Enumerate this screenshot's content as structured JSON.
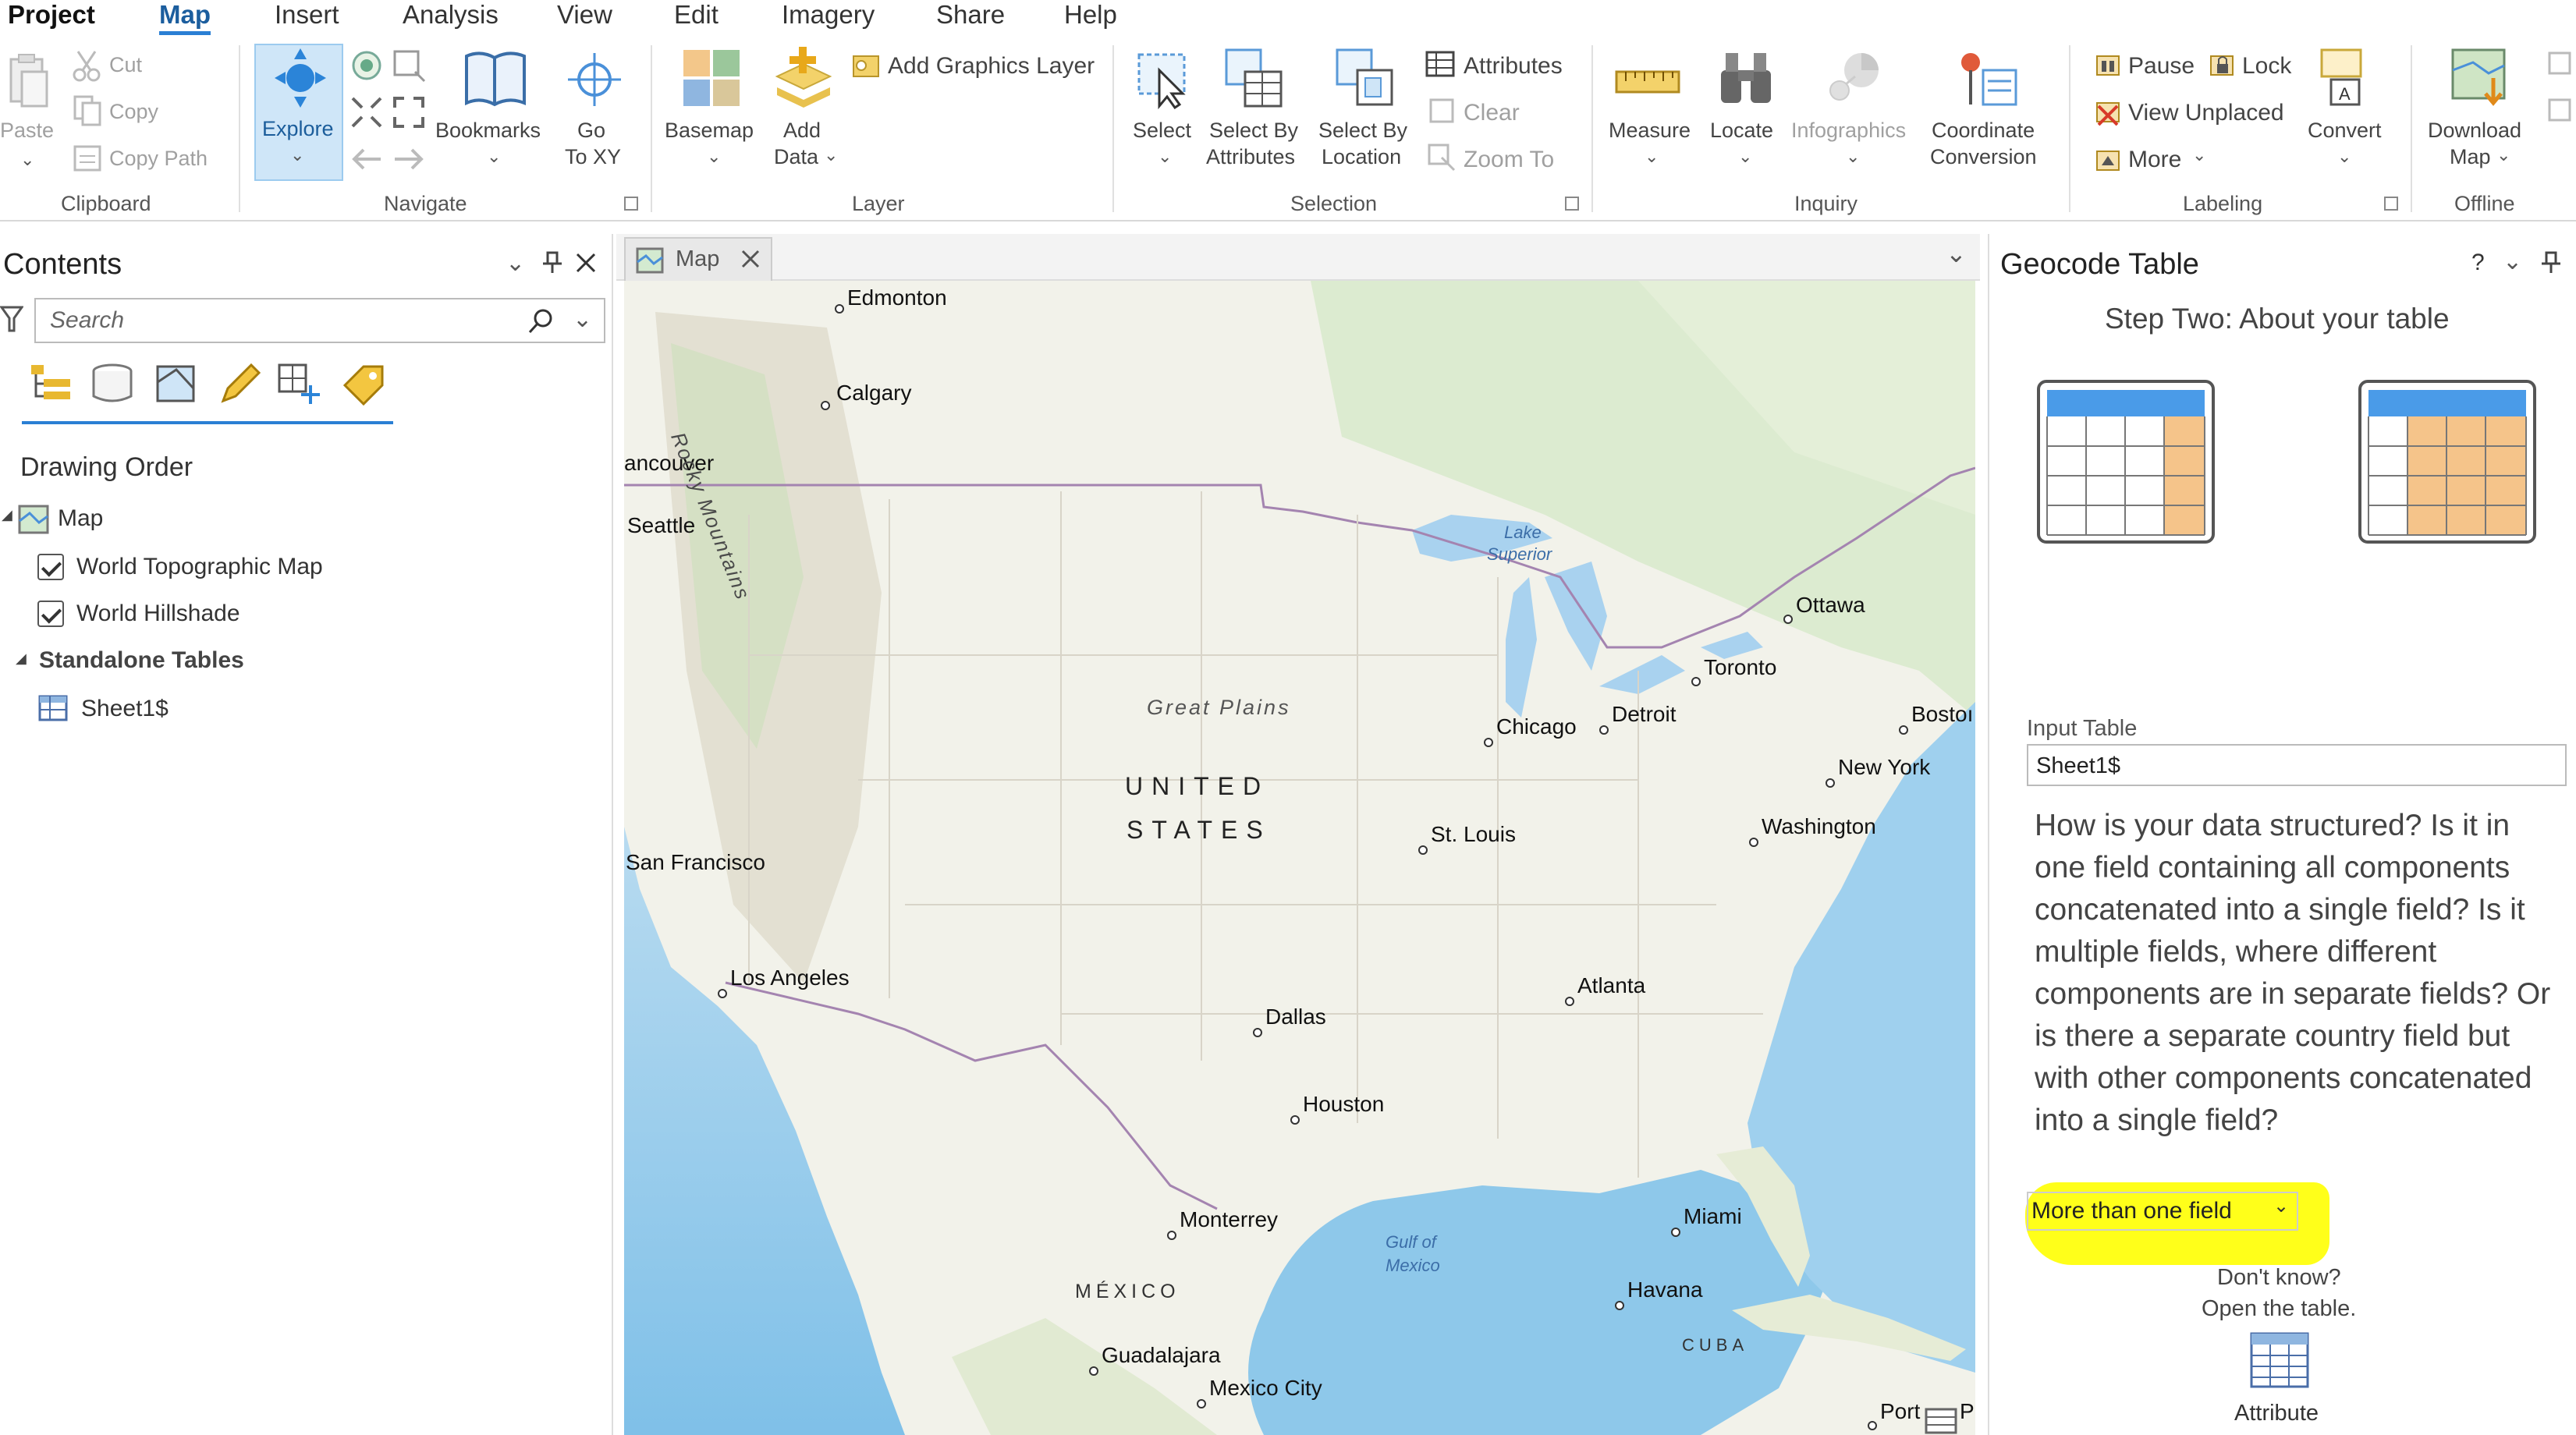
{
  "menu": {
    "tabs": [
      "Project",
      "Map",
      "Insert",
      "Analysis",
      "View",
      "Edit",
      "Imagery",
      "Share",
      "Help"
    ],
    "active": "Map"
  },
  "ribbon": {
    "clipboard": {
      "paste": "Paste",
      "cut": "Cut",
      "copy": "Copy",
      "copy_path": "Copy Path",
      "group": "Clipboard"
    },
    "navigate": {
      "explore": "Explore",
      "bookmarks": "Bookmarks",
      "go": "Go",
      "to_xy": "To XY",
      "group": "Navigate"
    },
    "layer": {
      "basemap": "Basemap",
      "add": "Add",
      "data": "Data",
      "add_graphics_layer": "Add Graphics Layer",
      "group": "Layer"
    },
    "selection": {
      "select": "Select",
      "select_by_1": "Select By",
      "attributes": "Attributes",
      "select_by_2": "Select By",
      "location": "Location",
      "attributes_btn": "Attributes",
      "clear": "Clear",
      "zoom_to": "Zoom To",
      "group": "Selection"
    },
    "inquiry": {
      "measure": "Measure",
      "locate": "Locate",
      "infographics": "Infographics",
      "coordinate": "Coordinate",
      "conversion": "Conversion",
      "group": "Inquiry"
    },
    "labeling": {
      "pause": "Pause",
      "lock": "Lock",
      "view_unplaced": "View Unplaced",
      "more": "More",
      "convert": "Convert",
      "group": "Labeling"
    },
    "offline": {
      "download": "Download",
      "map": "Map",
      "group": "Offline"
    }
  },
  "contents": {
    "title": "Contents",
    "search_placeholder": "Search",
    "drawing_order": "Drawing Order",
    "map": "Map",
    "layers": [
      "World Topographic Map",
      "World Hillshade"
    ],
    "standalone_tables": "Standalone Tables",
    "table": "Sheet1$"
  },
  "map_view": {
    "tab": "Map",
    "labels": {
      "edmonton": "Edmonton",
      "calgary": "Calgary",
      "vancouver": "ancouver",
      "seattle": "Seattle",
      "rocky": "Rocky Mountains",
      "lake_superior_1": "Lake",
      "lake_superior_2": "Superior",
      "ottawa": "Ottawa",
      "toronto": "Toronto",
      "detroit": "Detroit",
      "chicago": "Chicago",
      "boston": "Bostoı",
      "new_york": "New York",
      "washington": "Washington",
      "great_plains": "Great Plains",
      "united": "UNITED",
      "states": "STATES",
      "st_louis": "St. Louis",
      "san_francisco": "San Francisco",
      "los_angeles": "Los Angeles",
      "dallas": "Dallas",
      "atlanta": "Atlanta",
      "houston": "Houston",
      "monterrey": "Monterrey",
      "miami": "Miami",
      "gulf_1": "Gulf of",
      "gulf_2": "Mexico",
      "mexico": "MÉXICO",
      "havana": "Havana",
      "cuba": "CUBA",
      "guadalajara": "Guadalajara",
      "mexico_city": "Mexico City",
      "port": "Port",
      "p": "P"
    }
  },
  "geocode": {
    "title": "Geocode Table",
    "help": "?",
    "step": "Step Two: About your table",
    "input_table_label": "Input Table",
    "input_table_value": "Sheet1$",
    "question": "How is your data structured? Is it in one field containing all components concatenated into a single field? Is it multiple fields, where different components are in separate fields? Or is there a separate country field but with other components concatenated into a single field?",
    "dropdown_value": "More than one field",
    "dont_know": "Don't know?",
    "open_table": "Open the table.",
    "attribute": "Attribute",
    "highlight_color": "#ffff1a"
  }
}
